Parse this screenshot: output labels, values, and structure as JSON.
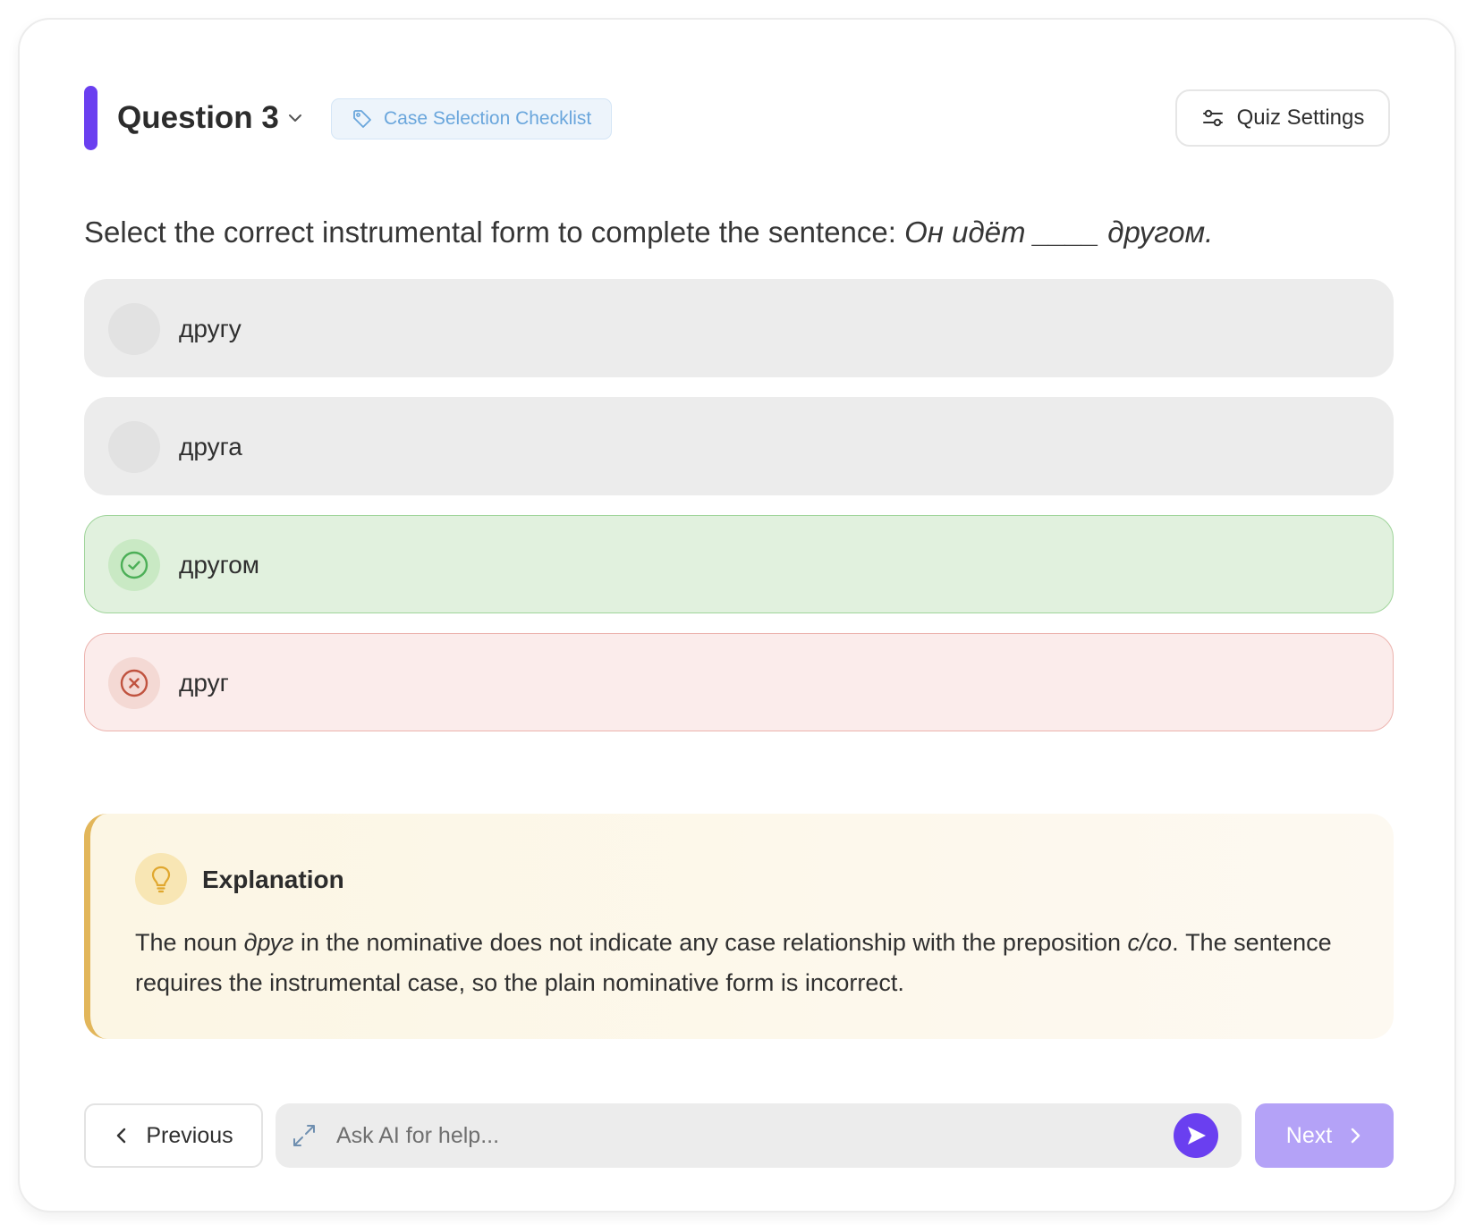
{
  "header": {
    "question_label": "Question 3",
    "tag_label": "Case Selection Checklist",
    "settings_label": "Quiz Settings"
  },
  "question": {
    "prefix": "Select the correct instrumental form to complete the sentence: ",
    "sentence": "Он идёт ____ другом."
  },
  "options": [
    {
      "label": "другу",
      "state": "neutral"
    },
    {
      "label": "друга",
      "state": "neutral"
    },
    {
      "label": "другом",
      "state": "correct"
    },
    {
      "label": "друг",
      "state": "wrong"
    }
  ],
  "explanation": {
    "title": "Explanation",
    "part1": "The noun ",
    "word": "друг",
    "part2": " in the nominative does not indicate any case relationship with the preposition ",
    "prep": "с/со",
    "part3": ". The sentence requires the instrumental case, so the plain nominative form is incorrect."
  },
  "footer": {
    "previous_label": "Previous",
    "ask_placeholder": "Ask AI for help...",
    "next_label": "Next"
  },
  "colors": {
    "accent": "#6a3ff0",
    "correct_bg": "#e1f1de",
    "wrong_bg": "#fbeceb",
    "explanation_border": "#e2b65a",
    "next_button": "#b4a2f7"
  },
  "icons": {
    "question_dropdown": "chevron-down-icon",
    "tag": "tag-icon",
    "settings": "sliders-icon",
    "correct": "check-circle-icon",
    "wrong": "x-circle-icon",
    "explanation": "lightbulb-icon",
    "previous": "chevron-left-icon",
    "expand": "expand-icon",
    "send": "send-icon",
    "next": "chevron-right-icon"
  }
}
